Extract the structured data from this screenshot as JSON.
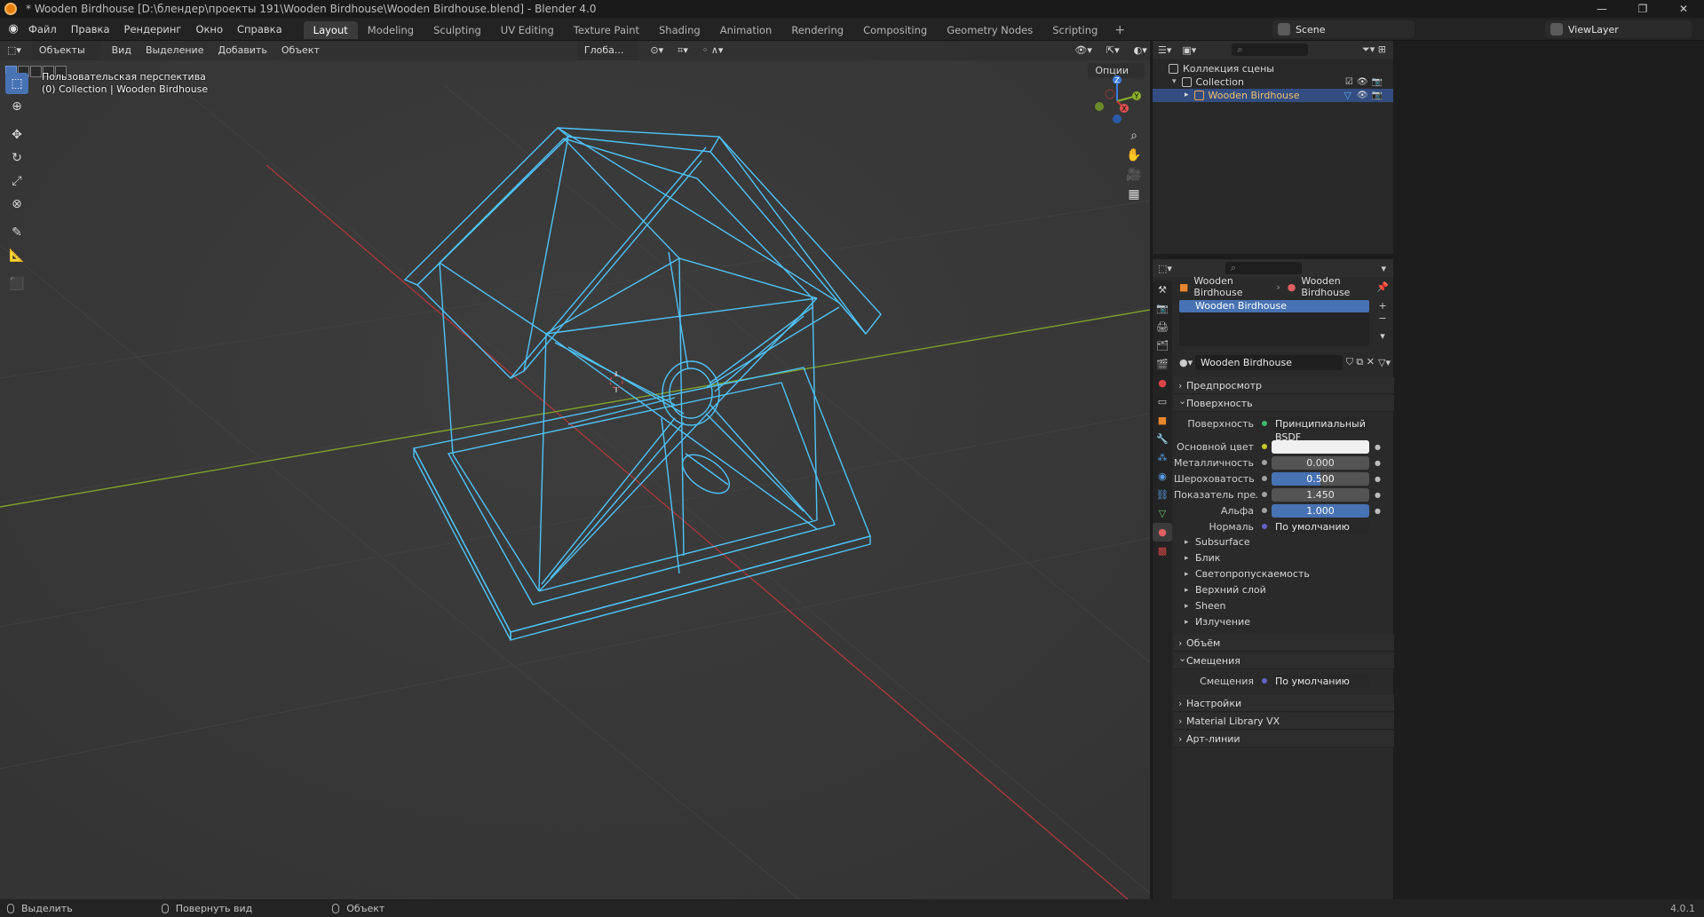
{
  "window": {
    "title": "* Wooden Birdhouse [D:\\блендер\\проекты 191\\Wooden Birdhouse\\Wooden Birdhouse.blend] - Blender 4.0",
    "controls": [
      "—",
      "❐",
      "✕"
    ]
  },
  "menu": [
    "Файл",
    "Правка",
    "Рендеринг",
    "Окно",
    "Справка"
  ],
  "workspaces": [
    "Layout",
    "Modeling",
    "Sculpting",
    "UV Editing",
    "Texture Paint",
    "Shading",
    "Animation",
    "Rendering",
    "Compositing",
    "Geometry Nodes",
    "Scripting"
  ],
  "workspace_add": "+",
  "active_workspace": "Layout",
  "scene": "Scene",
  "view_layer": "ViewLayer",
  "viewport": {
    "mode_dropdown": "Объекты",
    "menu": [
      "Вид",
      "Выделение",
      "Добавить",
      "Объект"
    ],
    "transform_orientation": "Глоба...",
    "options_label": "Опции",
    "info_line1": "Пользовательская перспектива",
    "info_line2": "(0) Collection | Wooden Birdhouse",
    "gizmo_axes": [
      "Z",
      "Y",
      "X"
    ]
  },
  "outliner": {
    "root": "Коллекция сцены",
    "collection": "Collection",
    "object": "Wooden Birdhouse"
  },
  "properties": {
    "breadcrumb_object": "Wooden Birdhouse",
    "breadcrumb_material": "Wooden Birdhouse",
    "slot": "Wooden Birdhouse",
    "material_name": "Wooden Birdhouse",
    "panels": {
      "preview": "Предпросмотр",
      "surface": "Поверхность",
      "volume": "Объём",
      "displacement": "Смещения",
      "settings": "Настройки",
      "material_library": "Material Library VX",
      "lineart": "Арт-линии"
    },
    "surface_rows": [
      {
        "label": "Поверхность",
        "value": "Принципиальный BSDF"
      },
      {
        "label": "Основной цвет",
        "value": ""
      },
      {
        "label": "Металличность",
        "value": "0.000"
      },
      {
        "label": "Шероховатость",
        "value": "0.500"
      },
      {
        "label": "Показатель прело...",
        "value": "1.450"
      },
      {
        "label": "Альфа",
        "value": "1.000"
      },
      {
        "label": "Нормаль",
        "value": "По умолчанию"
      }
    ],
    "subpanels": [
      "Subsurface",
      "Блик",
      "Светопропускаемость",
      "Верхний слой",
      "Sheen",
      "Излучение"
    ],
    "displacement_label": "Смещения",
    "displacement_value": "По умолчанию"
  },
  "statusbar": {
    "items": [
      "Выделить",
      "Повернуть вид",
      "Объект"
    ],
    "version": "4.0.1"
  },
  "colors": {
    "accent": "#4772b3",
    "wire": "#4fc3f7",
    "x_axis": "#c0393b",
    "y_axis": "#8bb02a"
  }
}
